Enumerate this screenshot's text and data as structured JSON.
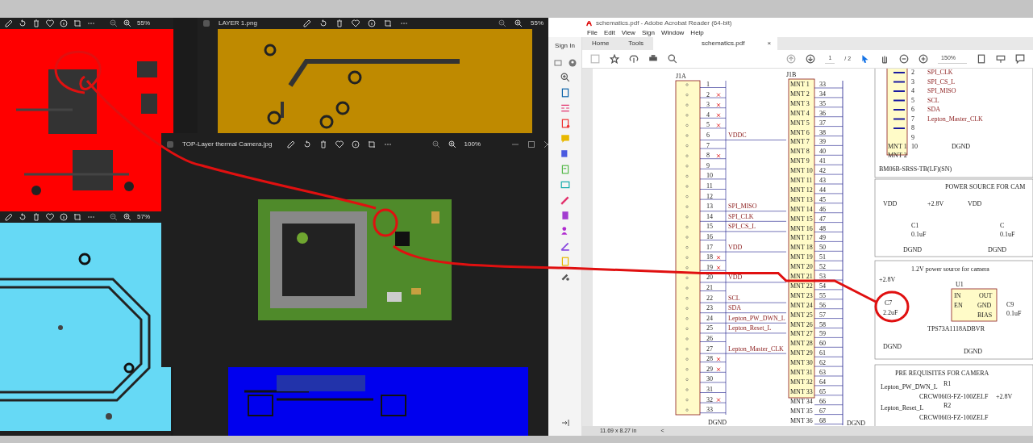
{
  "photo_windows": [
    {
      "kind": "toolbar_only",
      "zoom": "55%"
    },
    {
      "kind": "titled",
      "title": "LAYER 1.png",
      "zoom": "55%"
    },
    {
      "kind": "toolbar_only",
      "zoom": "57%"
    },
    {
      "kind": "image_only"
    },
    {
      "kind": "titled",
      "title": "TOP-Layer thermal Camera.jpg",
      "zoom": "100%"
    }
  ],
  "acrobat": {
    "title": "schematics.pdf - Adobe Acrobat Reader (64-bit)",
    "menu": [
      "File",
      "Edit",
      "View",
      "Sign",
      "Window",
      "Help"
    ],
    "tabs": [
      {
        "label": "Home",
        "selected": false
      },
      {
        "label": "Tools",
        "selected": false
      },
      {
        "label": "schematics.pdf",
        "selected": true,
        "close": "×"
      }
    ],
    "sign_in": "Sign In",
    "page": "1",
    "page_total": "/ 2",
    "zoom": "150%",
    "page_size": "11.69 x 8.27 in",
    "collapse": "<",
    "schematic": {
      "j1a": {
        "label": "J1A",
        "pins": [
          {
            "n": "1",
            "nc": false
          },
          {
            "n": "2",
            "nc": true
          },
          {
            "n": "3",
            "nc": true
          },
          {
            "n": "4",
            "nc": true
          },
          {
            "n": "5",
            "nc": true
          },
          {
            "n": "6",
            "signal": "VDDC",
            "nc": false
          },
          {
            "n": "7",
            "nc": false
          },
          {
            "n": "8",
            "nc": true
          },
          {
            "n": "9",
            "nc": false
          },
          {
            "n": "10",
            "nc": false
          },
          {
            "n": "11",
            "nc": false
          },
          {
            "n": "12",
            "nc": false
          },
          {
            "n": "13",
            "signal": "SPI_MISO",
            "nc": false
          },
          {
            "n": "14",
            "signal": "SPI_CLK",
            "nc": false
          },
          {
            "n": "15",
            "signal": "SPI_CS_L",
            "nc": false
          },
          {
            "n": "16",
            "nc": false
          },
          {
            "n": "17",
            "signal": "VDD",
            "nc": false
          },
          {
            "n": "18",
            "nc": true
          },
          {
            "n": "19",
            "nc": true
          },
          {
            "n": "20",
            "signal": "VDD",
            "nc": false
          },
          {
            "n": "21",
            "nc": false
          },
          {
            "n": "22",
            "signal": "SCL",
            "nc": false
          },
          {
            "n": "23",
            "signal": "SDA",
            "nc": false
          },
          {
            "n": "24",
            "signal": "Lepton_PW_DWN_L",
            "nc": false
          },
          {
            "n": "25",
            "signal": "Lepton_Reset_L",
            "nc": false
          },
          {
            "n": "26",
            "nc": false
          },
          {
            "n": "27",
            "signal": "Lepton_Master_CLK",
            "nc": false
          },
          {
            "n": "28",
            "nc": true
          },
          {
            "n": "29",
            "nc": true
          },
          {
            "n": "30",
            "nc": false
          },
          {
            "n": "31",
            "nc": false
          },
          {
            "n": "32",
            "nc": true
          },
          {
            "n": "33",
            "nc": false
          }
        ],
        "ground": "DGND"
      },
      "j1b": {
        "label": "J1B",
        "names": [
          "MNT 1",
          "MNT 2",
          "MNT 3",
          "MNT 4",
          "MNT 5",
          "MNT 6",
          "MNT 7",
          "MNT 8",
          "MNT 9",
          "MNT 10",
          "MNT 11",
          "MNT 12",
          "MNT 13",
          "MNT 14",
          "MNT 15",
          "MNT 16",
          "MNT 17",
          "MNT 18",
          "MNT 19",
          "MNT 20",
          "MNT 21",
          "MNT 22",
          "MNT 23",
          "MNT 24",
          "MNT 25",
          "MNT 26",
          "MNT 27",
          "MNT 28",
          "MNT 29",
          "MNT 30",
          "MNT 31",
          "MNT 32",
          "MNT 33",
          "MNT 34",
          "MNT 35",
          "MNT 36"
        ],
        "numbers": [
          "33",
          "34",
          "35",
          "36",
          "37",
          "38",
          "39",
          "40",
          "41",
          "42",
          "43",
          "44",
          "45",
          "46",
          "47",
          "48",
          "49",
          "50",
          "51",
          "52",
          "53",
          "54",
          "55",
          "56",
          "57",
          "58",
          "59",
          "60",
          "61",
          "62",
          "63",
          "64",
          "65",
          "66",
          "67",
          "68"
        ],
        "ground": "DGND"
      },
      "connector": {
        "pins": [
          {
            "n": "2",
            "signal": "SPI_CLK"
          },
          {
            "n": "3",
            "signal": "SPI_CS_L"
          },
          {
            "n": "4",
            "signal": "SPI_MISO"
          },
          {
            "n": "5",
            "signal": "SCL"
          },
          {
            "n": "6",
            "signal": "SDA"
          },
          {
            "n": "7",
            "signal": "Lepton_Master_CLK"
          },
          {
            "n": "8"
          },
          {
            "n": "9"
          },
          {
            "n": "10"
          }
        ],
        "mounts": [
          "MNT 1",
          "MNT 2"
        ],
        "ground": "DGND",
        "part": "BM06B-SRSS-TB(LF)(SN)"
      },
      "power": {
        "title": "POWER SOURCE FOR CAM",
        "texts": [
          "VDD",
          "+2.8V",
          "C1",
          "0.1uF",
          "DGND",
          "VDD",
          "C",
          "0.1uF",
          "DGND"
        ]
      },
      "regulator": {
        "title": "1.2V power source for camera",
        "texts": [
          "+2.8V",
          "U1",
          "IN",
          "EN",
          "OUT",
          "GND",
          "BIAS",
          "TPS73A1118ADBVR",
          "C7",
          "2.2uF",
          "DGND",
          "C9",
          "0.1uF",
          "DGND"
        ]
      },
      "prereq": {
        "title": "PRE REQUISITES FOR CAMERA",
        "texts": [
          "Lepton_PW_DWN_L",
          "R1",
          "CRCW0603-FZ-100ZELF",
          "+2.8V",
          "Lepton_Reset_L",
          "R2",
          "CRCW0603-FZ-100ZELF"
        ]
      }
    }
  }
}
